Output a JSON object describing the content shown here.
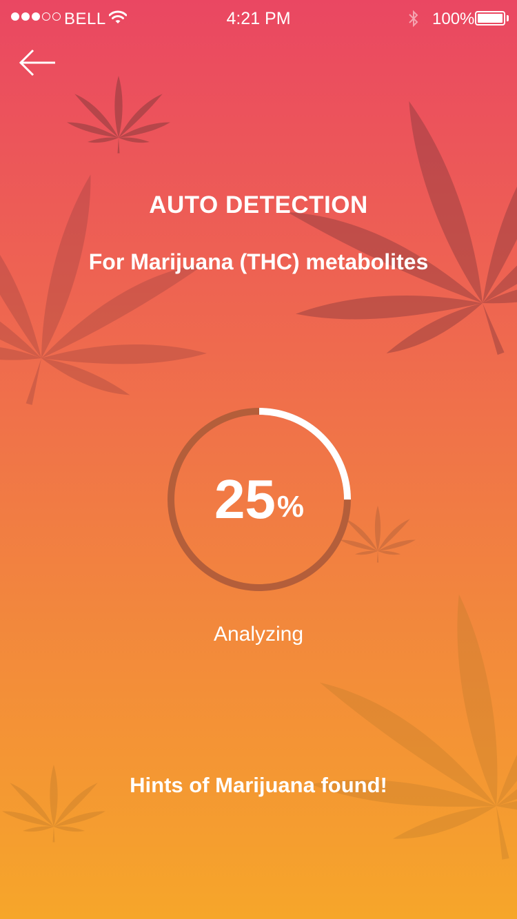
{
  "status_bar": {
    "carrier": "BELL",
    "time": "4:21 PM",
    "battery": "100%",
    "signal_icon": "signal-dots-icon",
    "wifi_icon": "wifi-icon",
    "bluetooth_icon": "bluetooth-icon",
    "battery_icon": "battery-icon"
  },
  "nav": {
    "back_icon": "arrow-left-icon"
  },
  "header": {
    "title": "AUTO DETECTION",
    "subtitle": "For Marijuana (THC) metabolites"
  },
  "progress": {
    "value": "25",
    "unit": "%",
    "fraction": 0.25,
    "label": "Analyzing"
  },
  "result": {
    "text": "Hints of Marijuana found!"
  },
  "colors": {
    "gradient_top": "#ea4762",
    "gradient_bottom": "#f6a62a",
    "ring_track": "#b45e3a",
    "ring_progress": "#ffffff"
  }
}
